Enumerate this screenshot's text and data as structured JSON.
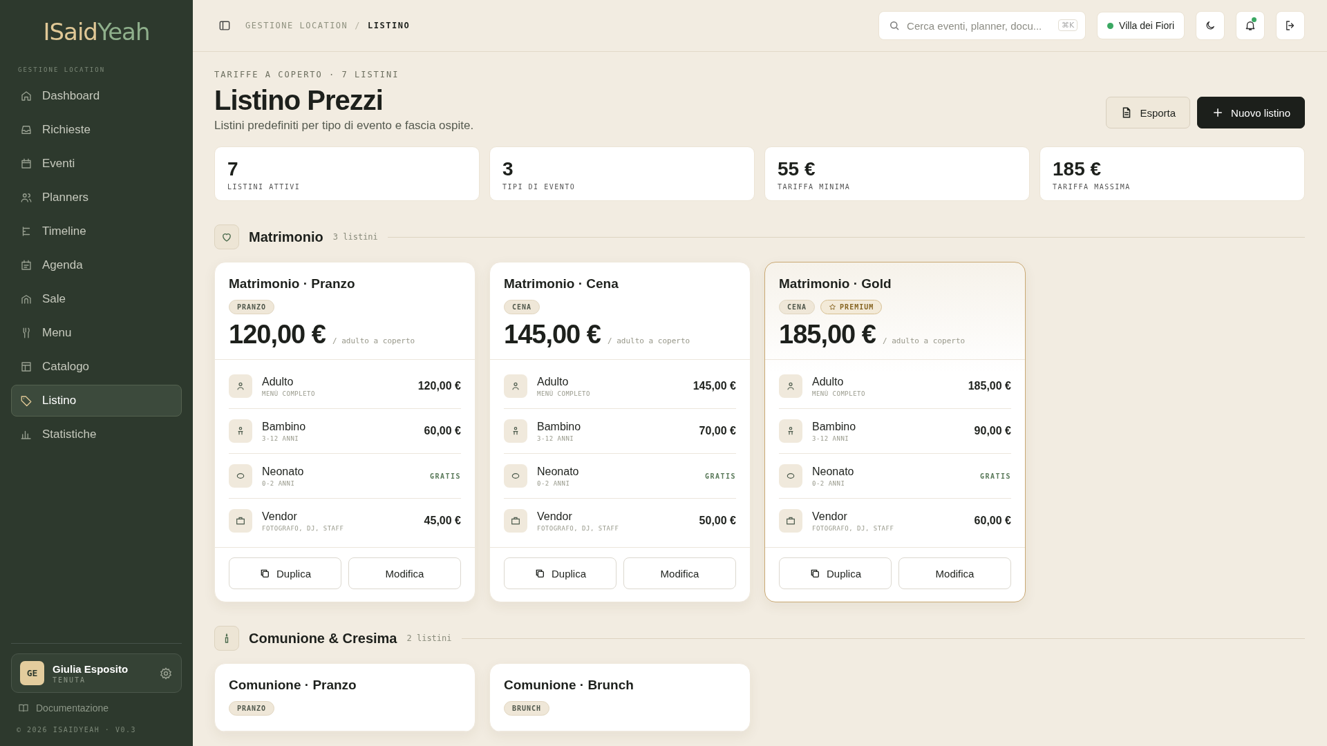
{
  "sidebar": {
    "logo": [
      "ISaid",
      "Yeah"
    ],
    "section_label": "GESTIONE LOCATION",
    "items": [
      {
        "label": "Dashboard",
        "selected": false
      },
      {
        "label": "Richieste",
        "selected": false
      },
      {
        "label": "Eventi",
        "selected": false
      },
      {
        "label": "Planners",
        "selected": false
      },
      {
        "label": "Timeline",
        "selected": false
      },
      {
        "label": "Agenda",
        "selected": false
      },
      {
        "label": "Sale",
        "selected": false
      },
      {
        "label": "Menu",
        "selected": false
      },
      {
        "label": "Catalogo",
        "selected": false
      },
      {
        "label": "Listino",
        "selected": true
      },
      {
        "label": "Statistiche",
        "selected": false
      }
    ],
    "user": {
      "initials": "GE",
      "name": "Giulia Esposito",
      "role": "TENUTA"
    },
    "docs_link": "Documentazione",
    "footer": "© 2026 ISAIDYEAH · V0.3"
  },
  "header": {
    "breadcrumb": [
      "GESTIONE LOCATION",
      "LISTINO"
    ],
    "separator": "/",
    "search": {
      "placeholder": "Cerca eventi, planner, docu...",
      "shortcut": "⌘K"
    },
    "venue": {
      "name": "Villa dei Fiori",
      "color": "#3aa862"
    },
    "notifications": {
      "unread": true
    }
  },
  "page": {
    "eyebrow": "TARIFFE A COPERTO · 7 LISTINI",
    "title": "Listino Prezzi",
    "subtitle": "Listini predefiniti per tipo di evento e fascia ospite.",
    "buttons": [
      {
        "label": "Esporta",
        "kind": "secondary"
      },
      {
        "label": "Nuovo listino",
        "kind": "primary"
      }
    ]
  },
  "stats": [
    {
      "value": "7",
      "label": "LISTINI ATTIVI"
    },
    {
      "value": "3",
      "label": "TIPI DI EVENTO"
    },
    {
      "value": "55 €",
      "label": "TARIFFA MINIMA"
    },
    {
      "value": "185 €",
      "label": "TARIFFA MASSIMA"
    }
  ],
  "sections": [
    {
      "title": "Matrimonio",
      "count": "3 listini",
      "kind": "heart",
      "lists": [
        {
          "title": "Matrimonio · Pranzo",
          "featured": false,
          "tags": [
            {
              "label": "PRANZO",
              "kind": "plain"
            }
          ],
          "price": "120,00 €",
          "unit": "/ adulto a coperto",
          "rows": [
            {
              "label": "Adulto",
              "sub": "MENÙ COMPLETO",
              "price": "120,00 €",
              "kind": "price"
            },
            {
              "label": "Bambino",
              "sub": "3-12 ANNI",
              "price": "60,00 €",
              "kind": "price"
            },
            {
              "label": "Neonato",
              "sub": "0-2 ANNI",
              "price": "GRATIS",
              "kind": "free"
            },
            {
              "label": "Vendor",
              "sub": "FOTOGRAFO, DJ, STAFF",
              "price": "45,00 €",
              "kind": "price"
            }
          ],
          "actions": [
            "Duplica",
            "Modifica"
          ]
        },
        {
          "title": "Matrimonio · Cena",
          "featured": false,
          "tags": [
            {
              "label": "CENA",
              "kind": "plain"
            }
          ],
          "price": "145,00 €",
          "unit": "/ adulto a coperto",
          "rows": [
            {
              "label": "Adulto",
              "sub": "MENÙ COMPLETO",
              "price": "145,00 €",
              "kind": "price"
            },
            {
              "label": "Bambino",
              "sub": "3-12 ANNI",
              "price": "70,00 €",
              "kind": "price"
            },
            {
              "label": "Neonato",
              "sub": "0-2 ANNI",
              "price": "GRATIS",
              "kind": "free"
            },
            {
              "label": "Vendor",
              "sub": "FOTOGRAFO, DJ, STAFF",
              "price": "50,00 €",
              "kind": "price"
            }
          ],
          "actions": [
            "Duplica",
            "Modifica"
          ]
        },
        {
          "title": "Matrimonio · Gold",
          "featured": true,
          "tags": [
            {
              "label": "CENA",
              "kind": "plain"
            },
            {
              "label": "PREMIUM",
              "kind": "premium"
            }
          ],
          "price": "185,00 €",
          "unit": "/ adulto a coperto",
          "rows": [
            {
              "label": "Adulto",
              "sub": "MENÙ COMPLETO",
              "price": "185,00 €",
              "kind": "price"
            },
            {
              "label": "Bambino",
              "sub": "3-12 ANNI",
              "price": "90,00 €",
              "kind": "price"
            },
            {
              "label": "Neonato",
              "sub": "0-2 ANNI",
              "price": "GRATIS",
              "kind": "free"
            },
            {
              "label": "Vendor",
              "sub": "FOTOGRAFO, DJ, STAFF",
              "price": "60,00 €",
              "kind": "price"
            }
          ],
          "actions": [
            "Duplica",
            "Modifica"
          ]
        }
      ]
    },
    {
      "title": "Comunione & Cresima",
      "count": "2 listini",
      "kind": "candle",
      "lists": [
        {
          "title": "Comunione · Pranzo",
          "featured": false,
          "tags": [
            {
              "label": "PRANZO",
              "kind": "plain"
            }
          ]
        },
        {
          "title": "Comunione · Brunch",
          "featured": false,
          "tags": [
            {
              "label": "BRUNCH",
              "kind": "plain"
            }
          ]
        }
      ]
    }
  ]
}
